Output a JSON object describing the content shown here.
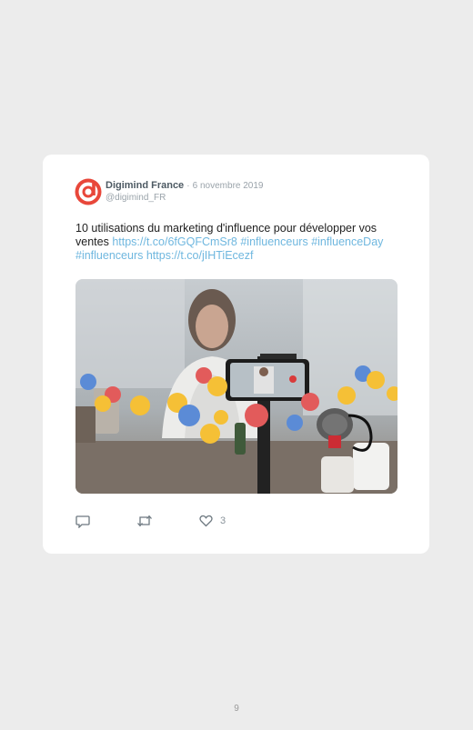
{
  "tweet": {
    "author_name": "Digimind France",
    "separator": "·",
    "date": "6 novembre 2019",
    "handle": "@digimind_FR",
    "text_plain": "10 utilisations du marketing d'influence pour développer vos ventes ",
    "link1": "https://t.co/6fGQFCmSr8",
    "tag1": "#influenceurs",
    "tag2": "#influenceDay",
    "tag3": "#influenceurs",
    "link2": "https://t.co/jIHTiEcezf",
    "like_count": "3"
  },
  "icons": {
    "avatar": "digimind-logo-icon",
    "reply": "reply-icon",
    "retweet": "retweet-icon",
    "like": "heart-icon"
  },
  "colors": {
    "link": "#6fb7df",
    "brand": "#e8473a",
    "background": "#ececec"
  },
  "page": {
    "number": "9"
  }
}
